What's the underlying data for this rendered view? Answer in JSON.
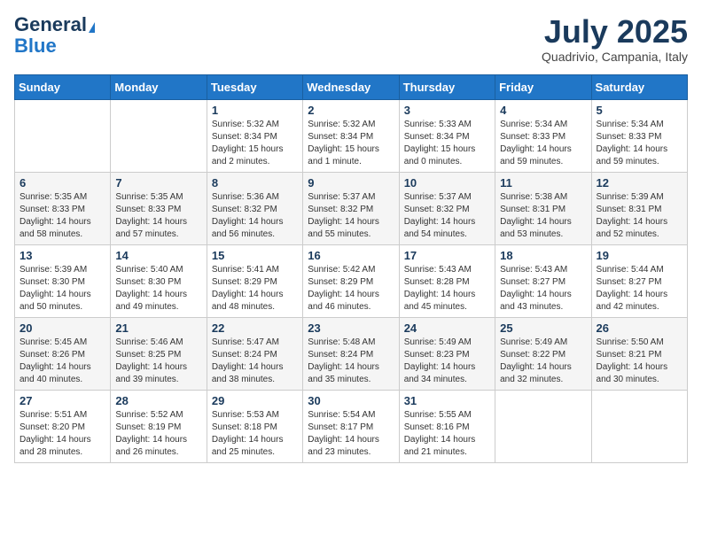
{
  "header": {
    "logo_line1": "General",
    "logo_line2": "Blue",
    "month": "July 2025",
    "location": "Quadrivio, Campania, Italy"
  },
  "weekdays": [
    "Sunday",
    "Monday",
    "Tuesday",
    "Wednesday",
    "Thursday",
    "Friday",
    "Saturday"
  ],
  "weeks": [
    [
      {
        "day": "",
        "sunrise": "",
        "sunset": "",
        "daylight": ""
      },
      {
        "day": "",
        "sunrise": "",
        "sunset": "",
        "daylight": ""
      },
      {
        "day": "1",
        "sunrise": "Sunrise: 5:32 AM",
        "sunset": "Sunset: 8:34 PM",
        "daylight": "Daylight: 15 hours and 2 minutes."
      },
      {
        "day": "2",
        "sunrise": "Sunrise: 5:32 AM",
        "sunset": "Sunset: 8:34 PM",
        "daylight": "Daylight: 15 hours and 1 minute."
      },
      {
        "day": "3",
        "sunrise": "Sunrise: 5:33 AM",
        "sunset": "Sunset: 8:34 PM",
        "daylight": "Daylight: 15 hours and 0 minutes."
      },
      {
        "day": "4",
        "sunrise": "Sunrise: 5:34 AM",
        "sunset": "Sunset: 8:33 PM",
        "daylight": "Daylight: 14 hours and 59 minutes."
      },
      {
        "day": "5",
        "sunrise": "Sunrise: 5:34 AM",
        "sunset": "Sunset: 8:33 PM",
        "daylight": "Daylight: 14 hours and 59 minutes."
      }
    ],
    [
      {
        "day": "6",
        "sunrise": "Sunrise: 5:35 AM",
        "sunset": "Sunset: 8:33 PM",
        "daylight": "Daylight: 14 hours and 58 minutes."
      },
      {
        "day": "7",
        "sunrise": "Sunrise: 5:35 AM",
        "sunset": "Sunset: 8:33 PM",
        "daylight": "Daylight: 14 hours and 57 minutes."
      },
      {
        "day": "8",
        "sunrise": "Sunrise: 5:36 AM",
        "sunset": "Sunset: 8:32 PM",
        "daylight": "Daylight: 14 hours and 56 minutes."
      },
      {
        "day": "9",
        "sunrise": "Sunrise: 5:37 AM",
        "sunset": "Sunset: 8:32 PM",
        "daylight": "Daylight: 14 hours and 55 minutes."
      },
      {
        "day": "10",
        "sunrise": "Sunrise: 5:37 AM",
        "sunset": "Sunset: 8:32 PM",
        "daylight": "Daylight: 14 hours and 54 minutes."
      },
      {
        "day": "11",
        "sunrise": "Sunrise: 5:38 AM",
        "sunset": "Sunset: 8:31 PM",
        "daylight": "Daylight: 14 hours and 53 minutes."
      },
      {
        "day": "12",
        "sunrise": "Sunrise: 5:39 AM",
        "sunset": "Sunset: 8:31 PM",
        "daylight": "Daylight: 14 hours and 52 minutes."
      }
    ],
    [
      {
        "day": "13",
        "sunrise": "Sunrise: 5:39 AM",
        "sunset": "Sunset: 8:30 PM",
        "daylight": "Daylight: 14 hours and 50 minutes."
      },
      {
        "day": "14",
        "sunrise": "Sunrise: 5:40 AM",
        "sunset": "Sunset: 8:30 PM",
        "daylight": "Daylight: 14 hours and 49 minutes."
      },
      {
        "day": "15",
        "sunrise": "Sunrise: 5:41 AM",
        "sunset": "Sunset: 8:29 PM",
        "daylight": "Daylight: 14 hours and 48 minutes."
      },
      {
        "day": "16",
        "sunrise": "Sunrise: 5:42 AM",
        "sunset": "Sunset: 8:29 PM",
        "daylight": "Daylight: 14 hours and 46 minutes."
      },
      {
        "day": "17",
        "sunrise": "Sunrise: 5:43 AM",
        "sunset": "Sunset: 8:28 PM",
        "daylight": "Daylight: 14 hours and 45 minutes."
      },
      {
        "day": "18",
        "sunrise": "Sunrise: 5:43 AM",
        "sunset": "Sunset: 8:27 PM",
        "daylight": "Daylight: 14 hours and 43 minutes."
      },
      {
        "day": "19",
        "sunrise": "Sunrise: 5:44 AM",
        "sunset": "Sunset: 8:27 PM",
        "daylight": "Daylight: 14 hours and 42 minutes."
      }
    ],
    [
      {
        "day": "20",
        "sunrise": "Sunrise: 5:45 AM",
        "sunset": "Sunset: 8:26 PM",
        "daylight": "Daylight: 14 hours and 40 minutes."
      },
      {
        "day": "21",
        "sunrise": "Sunrise: 5:46 AM",
        "sunset": "Sunset: 8:25 PM",
        "daylight": "Daylight: 14 hours and 39 minutes."
      },
      {
        "day": "22",
        "sunrise": "Sunrise: 5:47 AM",
        "sunset": "Sunset: 8:24 PM",
        "daylight": "Daylight: 14 hours and 38 minutes."
      },
      {
        "day": "23",
        "sunrise": "Sunrise: 5:48 AM",
        "sunset": "Sunset: 8:24 PM",
        "daylight": "Daylight: 14 hours and 35 minutes."
      },
      {
        "day": "24",
        "sunrise": "Sunrise: 5:49 AM",
        "sunset": "Sunset: 8:23 PM",
        "daylight": "Daylight: 14 hours and 34 minutes."
      },
      {
        "day": "25",
        "sunrise": "Sunrise: 5:49 AM",
        "sunset": "Sunset: 8:22 PM",
        "daylight": "Daylight: 14 hours and 32 minutes."
      },
      {
        "day": "26",
        "sunrise": "Sunrise: 5:50 AM",
        "sunset": "Sunset: 8:21 PM",
        "daylight": "Daylight: 14 hours and 30 minutes."
      }
    ],
    [
      {
        "day": "27",
        "sunrise": "Sunrise: 5:51 AM",
        "sunset": "Sunset: 8:20 PM",
        "daylight": "Daylight: 14 hours and 28 minutes."
      },
      {
        "day": "28",
        "sunrise": "Sunrise: 5:52 AM",
        "sunset": "Sunset: 8:19 PM",
        "daylight": "Daylight: 14 hours and 26 minutes."
      },
      {
        "day": "29",
        "sunrise": "Sunrise: 5:53 AM",
        "sunset": "Sunset: 8:18 PM",
        "daylight": "Daylight: 14 hours and 25 minutes."
      },
      {
        "day": "30",
        "sunrise": "Sunrise: 5:54 AM",
        "sunset": "Sunset: 8:17 PM",
        "daylight": "Daylight: 14 hours and 23 minutes."
      },
      {
        "day": "31",
        "sunrise": "Sunrise: 5:55 AM",
        "sunset": "Sunset: 8:16 PM",
        "daylight": "Daylight: 14 hours and 21 minutes."
      },
      {
        "day": "",
        "sunrise": "",
        "sunset": "",
        "daylight": ""
      },
      {
        "day": "",
        "sunrise": "",
        "sunset": "",
        "daylight": ""
      }
    ]
  ]
}
